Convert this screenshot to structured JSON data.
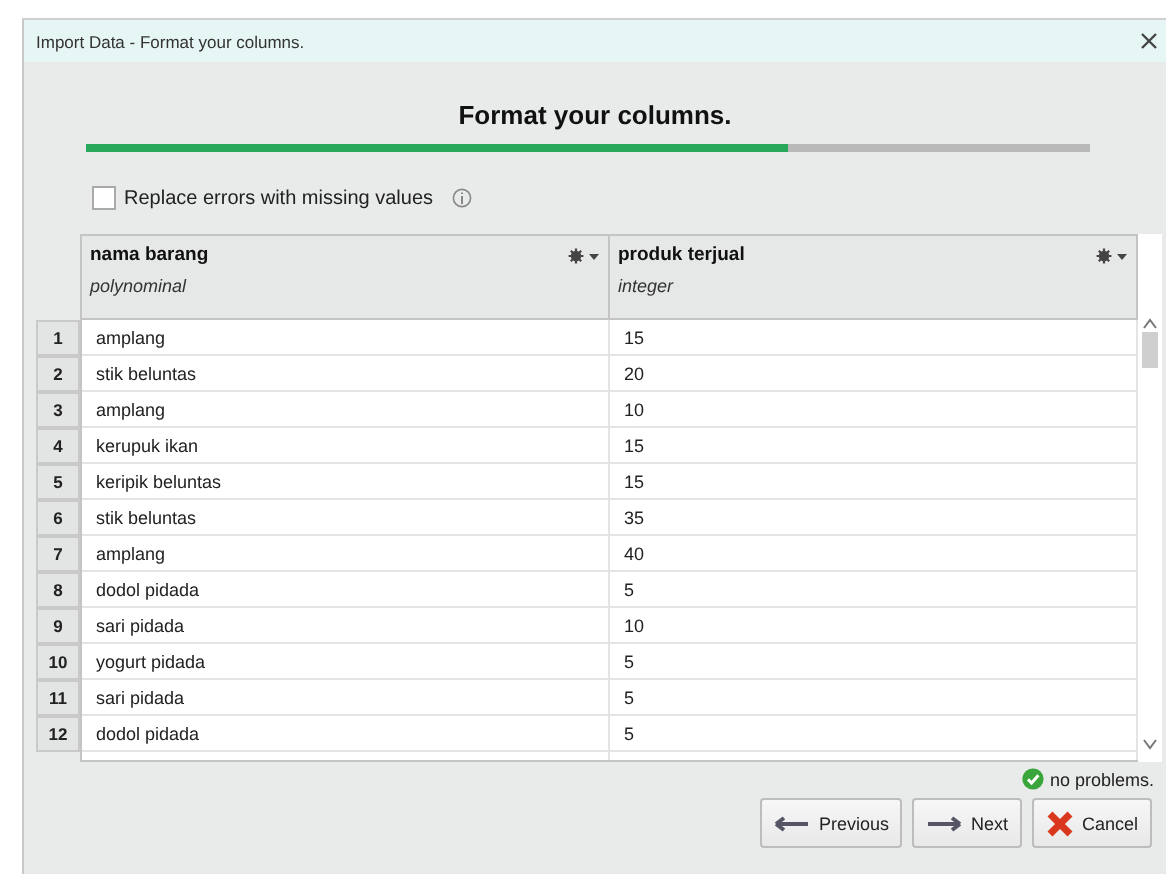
{
  "window": {
    "title": "Import Data - Format your columns."
  },
  "heading": "Format your columns.",
  "progress": {
    "level": 0.7
  },
  "replace_errors": {
    "label": "Replace errors with missing values",
    "checked": false
  },
  "table": {
    "columns": [
      {
        "name": "nama barang",
        "type": "polynominal"
      },
      {
        "name": "produk terjual",
        "type": "integer"
      }
    ],
    "rows": [
      {
        "number": "1",
        "cells": [
          "amplang",
          "15"
        ]
      },
      {
        "number": "2",
        "cells": [
          "stik beluntas",
          "20"
        ]
      },
      {
        "number": "3",
        "cells": [
          "amplang",
          "10"
        ]
      },
      {
        "number": "4",
        "cells": [
          "kerupuk ikan",
          "15"
        ]
      },
      {
        "number": "5",
        "cells": [
          "keripik beluntas",
          "15"
        ]
      },
      {
        "number": "6",
        "cells": [
          "stik beluntas",
          "35"
        ]
      },
      {
        "number": "7",
        "cells": [
          "amplang",
          "40"
        ]
      },
      {
        "number": "8",
        "cells": [
          "dodol pidada",
          "5"
        ]
      },
      {
        "number": "9",
        "cells": [
          "sari pidada",
          "10"
        ]
      },
      {
        "number": "10",
        "cells": [
          "yogurt pidada",
          "5"
        ]
      },
      {
        "number": "11",
        "cells": [
          "sari pidada",
          "5"
        ]
      },
      {
        "number": "12",
        "cells": [
          "dodol pidada",
          "5"
        ]
      }
    ]
  },
  "status": "no problems.",
  "buttons": [
    {
      "kind": "previous",
      "label": "Previous"
    },
    {
      "kind": "next",
      "label": "Next"
    },
    {
      "kind": "cancel",
      "label": "Cancel"
    }
  ]
}
